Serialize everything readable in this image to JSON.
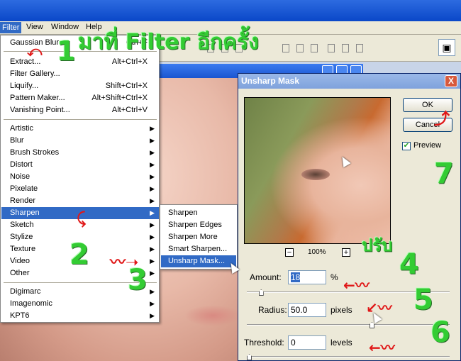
{
  "menubar": {
    "items": [
      "Filter",
      "View",
      "Window",
      "Help"
    ]
  },
  "filter_menu": {
    "group1": [
      {
        "label": "Gaussian Blur",
        "shortcut": "Ctrl+F"
      }
    ],
    "group2": [
      {
        "label": "Extract...",
        "shortcut": "Alt+Ctrl+X"
      },
      {
        "label": "Filter Gallery...",
        "shortcut": ""
      },
      {
        "label": "Liquify...",
        "shortcut": "Shift+Ctrl+X"
      },
      {
        "label": "Pattern Maker...",
        "shortcut": "Alt+Shift+Ctrl+X"
      },
      {
        "label": "Vanishing Point...",
        "shortcut": "Alt+Ctrl+V"
      }
    ],
    "group3": [
      "Artistic",
      "Blur",
      "Brush Strokes",
      "Distort",
      "Noise",
      "Pixelate",
      "Render",
      "Sharpen",
      "Sketch",
      "Stylize",
      "Texture",
      "Video",
      "Other"
    ],
    "group4": [
      "Digimarc",
      "Imagenomic",
      "KPT6"
    ],
    "highlighted": "Sharpen"
  },
  "sharpen_submenu": [
    "Sharpen",
    "Sharpen Edges",
    "Sharpen More",
    "Smart Sharpen...",
    "Unsharp Mask..."
  ],
  "dialog": {
    "title": "Unsharp Mask",
    "close": "X",
    "ok_label": "OK",
    "cancel_label": "Cancel",
    "preview_label": "Preview",
    "preview_checked": true,
    "zoom": "100%",
    "zoom_minus": "−",
    "zoom_plus": "+",
    "amount_label": "Amount:",
    "amount_value": "18",
    "amount_unit": "%",
    "amount_level": 0.06,
    "radius_label": "Radius:",
    "radius_value": "50.0",
    "radius_unit": "pixels",
    "radius_level": 0.62,
    "threshold_label": "Threshold:",
    "threshold_value": "0",
    "threshold_unit": "levels",
    "threshold_level": 0.0
  },
  "annotations": {
    "title_thai": "มาที่ Filter อีกครั้ง",
    "adjust_thai": "ปรับ",
    "steps": [
      "1",
      "2",
      "3",
      "4",
      "5",
      "6",
      "7"
    ]
  },
  "colors": {
    "highlight": "#316ac5",
    "annotation_green": "#33cc33",
    "arrow_red": "#e01818"
  }
}
